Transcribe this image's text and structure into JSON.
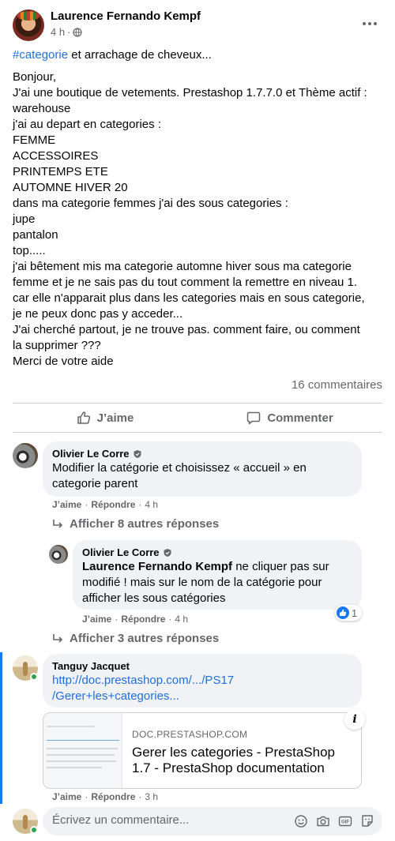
{
  "post": {
    "author": "Laurence Fernando Kempf",
    "time": "4 h",
    "separator": "·",
    "hashtag": "#categorie",
    "first_line_rest": " et arrachage de cheveux...",
    "body_lines": [
      "Bonjour,",
      "J'ai une boutique de vetements. Prestashop 1.7.7.0 et Thème actif :",
      "warehouse",
      "j'ai au depart en categories :",
      "FEMME",
      "ACCESSOIRES",
      "PRINTEMPS ETE",
      "AUTOMNE HIVER 20",
      "dans ma categorie femmes j'ai des sous categories :",
      "jupe",
      "pantalon",
      "top.....",
      "j'ai bêtement mis ma categorie automne hiver sous ma categorie",
      "femme et je ne sais pas du tout comment la remettre en niveau 1.",
      "car elle n'apparait plus dans les categories mais en sous categorie,",
      "je ne peux donc pas y acceder...",
      "J'ai cherché partout, je ne trouve pas. comment faire, ou comment",
      "la supprimer ???",
      "Merci de votre aide"
    ],
    "comment_count": "16 commentaires",
    "like_label": "J’aime",
    "comment_label": "Commenter"
  },
  "comments": [
    {
      "name": "Olivier Le Corre",
      "lines": [
        "Modifier la catégorie et choisissez « accueil » en",
        "categorie parent"
      ],
      "like": "J’aime",
      "reply": "Répondre",
      "time": "4 h",
      "more_replies": "Afficher 8 autres réponses"
    },
    {
      "name": "Olivier Le Corre",
      "mention": "Laurence Fernando Kempf",
      "first_rest": " ne cliquer pas sur",
      "lines": [
        "modifié ! mais sur le nom de la catégorie pour",
        "afficher les sous catégories"
      ],
      "like": "J’aime",
      "reply": "Répondre",
      "time": "4 h",
      "reaction_count": "1",
      "more_replies": "Afficher 3 autres réponses"
    },
    {
      "name": "Tanguy Jacquet",
      "link_lines": [
        "http://doc.prestashop.com/.../PS17",
        "/Gerer+les+categories..."
      ],
      "card_domain": "DOC.PRESTASHOP.COM",
      "card_title_lines": [
        "Gerer les categories - PrestaShop",
        "1.7 - PrestaShop documentation"
      ],
      "like": "J’aime",
      "reply": "Répondre",
      "time": "3 h"
    }
  ],
  "composer": {
    "placeholder": "Écrivez un commentaire..."
  },
  "colors": {
    "link": "#216fdb",
    "secondary_text": "#65676b",
    "bubble": "#f0f2f5",
    "thread_highlight": "#1877f2"
  }
}
